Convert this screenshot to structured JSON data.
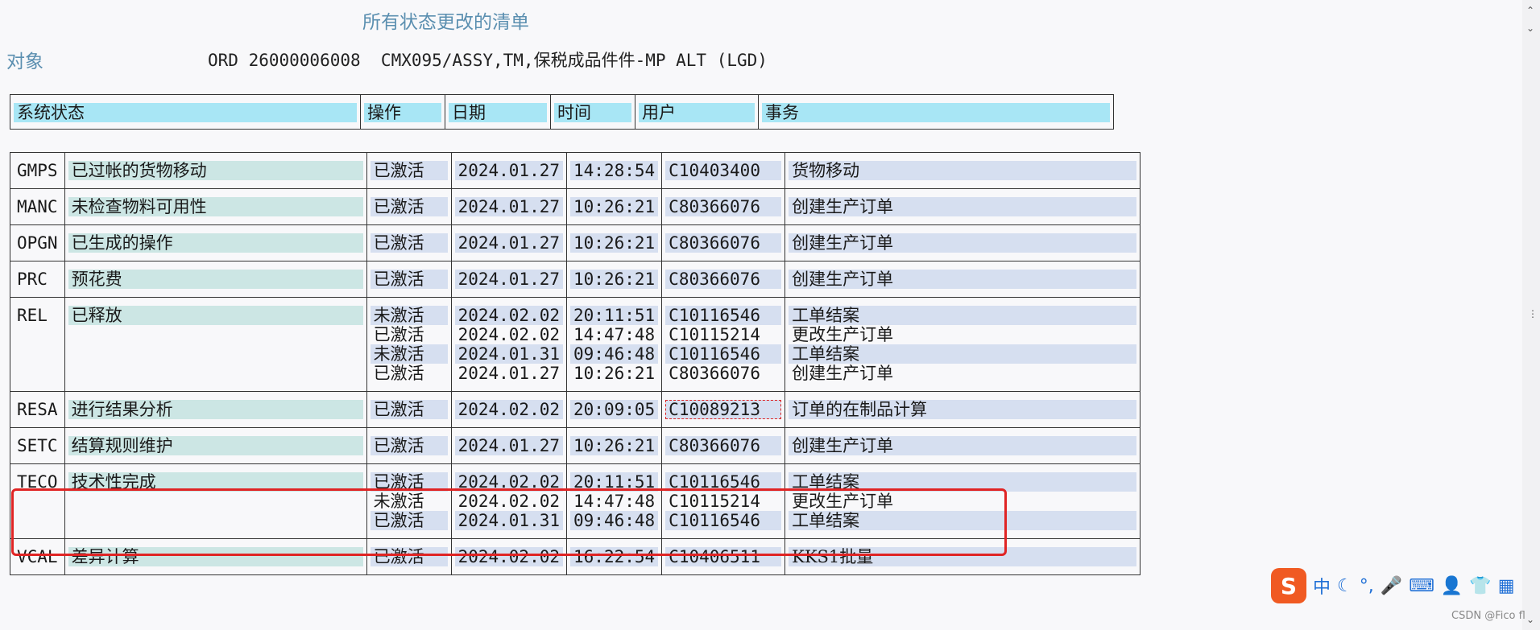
{
  "title": "所有状态更改的清单",
  "object": {
    "label": "对象",
    "value": "ORD 26000006008  CMX095/ASSY,TM,保税成品件件-MP ALT (LGD)"
  },
  "headers": {
    "status": "系统状态",
    "op": "操作",
    "date": "日期",
    "time": "时间",
    "user": "用户",
    "txn": "事务"
  },
  "rows": [
    {
      "code": "GMPS",
      "desc": "已过帐的货物移动",
      "entries": [
        {
          "op": "已激活",
          "date": "2024.01.27",
          "time": "14:28:54",
          "user": "C10403400",
          "txn": "货物移动"
        }
      ]
    },
    {
      "code": "MANC",
      "desc": "未检查物料可用性",
      "entries": [
        {
          "op": "已激活",
          "date": "2024.01.27",
          "time": "10:26:21",
          "user": "C80366076",
          "txn": "创建生产订单"
        }
      ]
    },
    {
      "code": "OPGN",
      "desc": "已生成的操作",
      "entries": [
        {
          "op": "已激活",
          "date": "2024.01.27",
          "time": "10:26:21",
          "user": "C80366076",
          "txn": "创建生产订单"
        }
      ]
    },
    {
      "code": "PRC",
      "desc": "预花费",
      "entries": [
        {
          "op": "已激活",
          "date": "2024.01.27",
          "time": "10:26:21",
          "user": "C80366076",
          "txn": "创建生产订单"
        }
      ]
    },
    {
      "code": "REL",
      "desc": "已释放",
      "entries": [
        {
          "op": "未激活",
          "date": "2024.02.02",
          "time": "20:11:51",
          "user": "C10116546",
          "txn": "工单结案"
        },
        {
          "op": "已激活",
          "date": "2024.02.02",
          "time": "14:47:48",
          "user": "C10115214",
          "txn": "更改生产订单"
        },
        {
          "op": "未激活",
          "date": "2024.01.31",
          "time": "09:46:48",
          "user": "C10116546",
          "txn": "工单结案"
        },
        {
          "op": "已激活",
          "date": "2024.01.27",
          "time": "10:26:21",
          "user": "C80366076",
          "txn": "创建生产订单"
        }
      ]
    },
    {
      "code": "RESA",
      "desc": "进行结果分析",
      "entries": [
        {
          "op": "已激活",
          "date": "2024.02.02",
          "time": "20:09:05",
          "user": "C10089213",
          "txn": "订单的在制品计算"
        }
      ]
    },
    {
      "code": "SETC",
      "desc": "结算规则维护",
      "entries": [
        {
          "op": "已激活",
          "date": "2024.01.27",
          "time": "10:26:21",
          "user": "C80366076",
          "txn": "创建生产订单"
        }
      ]
    },
    {
      "code": "TECO",
      "desc": "技术性完成",
      "entries": [
        {
          "op": "已激活",
          "date": "2024.02.02",
          "time": "20:11:51",
          "user": "C10116546",
          "txn": "工单结案"
        },
        {
          "op": "未激活",
          "date": "2024.02.02",
          "time": "14:47:48",
          "user": "C10115214",
          "txn": "更改生产订单"
        },
        {
          "op": "已激活",
          "date": "2024.01.31",
          "time": "09:46:48",
          "user": "C10116546",
          "txn": "工单结案"
        }
      ]
    },
    {
      "code": "VCAL",
      "desc": "差异计算",
      "entries": [
        {
          "op": "已激活",
          "date": "2024.02.02",
          "time": "16:22:54",
          "user": "C10406511",
          "txn": "KKS1批量"
        }
      ]
    }
  ],
  "ime": {
    "logo": "S",
    "lang": "中"
  },
  "watermark": "CSDN @Fico fl"
}
